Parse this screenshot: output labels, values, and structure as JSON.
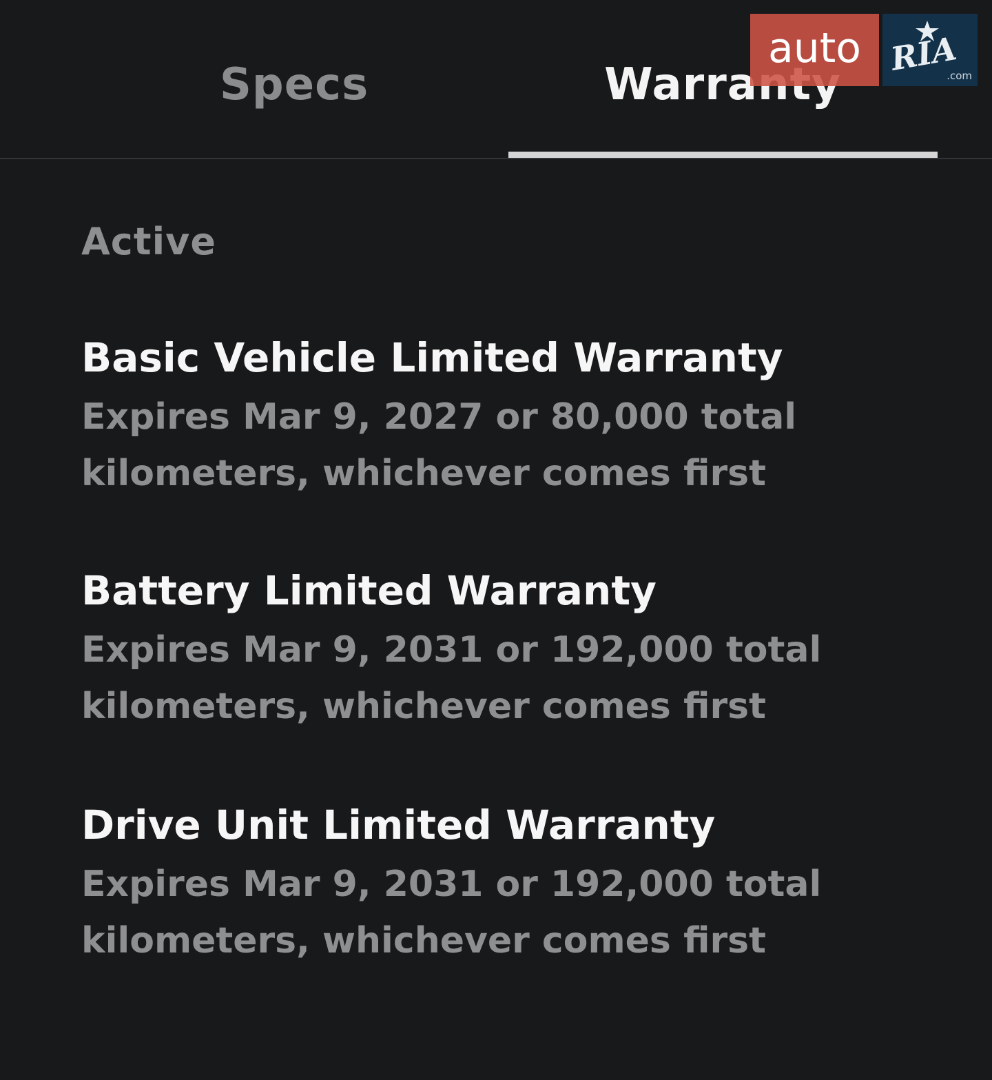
{
  "tabs": [
    {
      "label": "Specs",
      "selected": false
    },
    {
      "label": "Warranty",
      "selected": true
    }
  ],
  "watermark": {
    "auto": "auto",
    "ria": "RIA",
    "com": ".com"
  },
  "section": {
    "label": "Active"
  },
  "warranties": [
    {
      "title": "Basic Vehicle Limited Warranty",
      "detail": "Expires Mar 9, 2027 or 80,000 total kilometers, whichever comes first"
    },
    {
      "title": "Battery Limited Warranty",
      "detail": "Expires Mar 9, 2031 or 192,000 total kilometers, whichever comes first"
    },
    {
      "title": "Drive Unit Limited Warranty",
      "detail": "Expires Mar 9, 2031 or 192,000 total kilometers, whichever comes first"
    }
  ],
  "colors": {
    "background": "#18191b",
    "selected_tab": "#f4f4f4",
    "unselected_tab": "#8b8c8e",
    "secondary_text": "#8e8f91"
  }
}
